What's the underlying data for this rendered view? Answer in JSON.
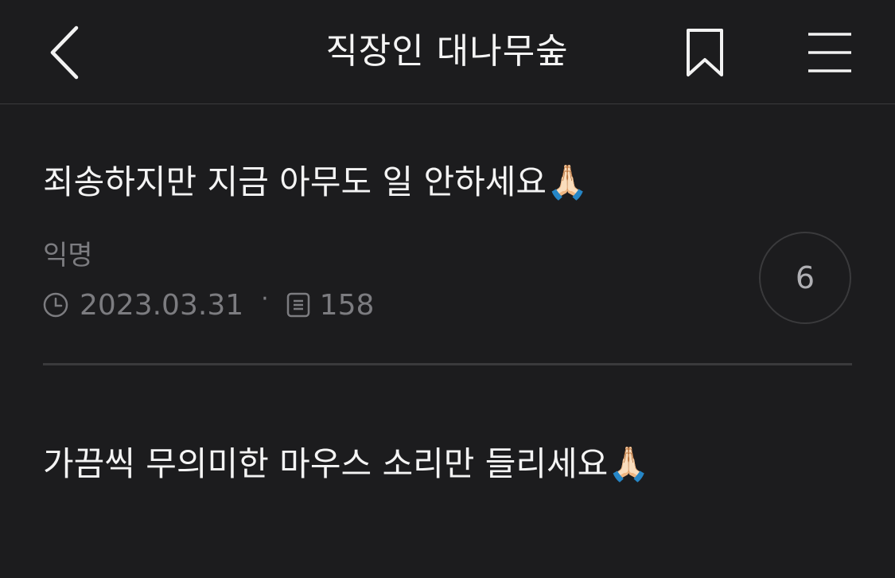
{
  "header": {
    "title": "직장인 대나무숲",
    "icons": {
      "back": "chevron-left-icon",
      "bookmark": "bookmark-icon",
      "menu": "hamburger-menu-icon"
    }
  },
  "post": {
    "title": "죄송하지만 지금 아무도 일 안하세요🙏🏻",
    "author": "익명",
    "date": "2023.03.31",
    "separator": "·",
    "views": "158",
    "comment_count": "6",
    "body": "가끔씩 무의미한 마우스 소리만 들리세요🙏🏻"
  },
  "colors": {
    "background": "#1c1c1e",
    "text_primary": "#f4f4f4",
    "text_secondary": "#7c7c80",
    "divider": "#3a3a3c"
  }
}
